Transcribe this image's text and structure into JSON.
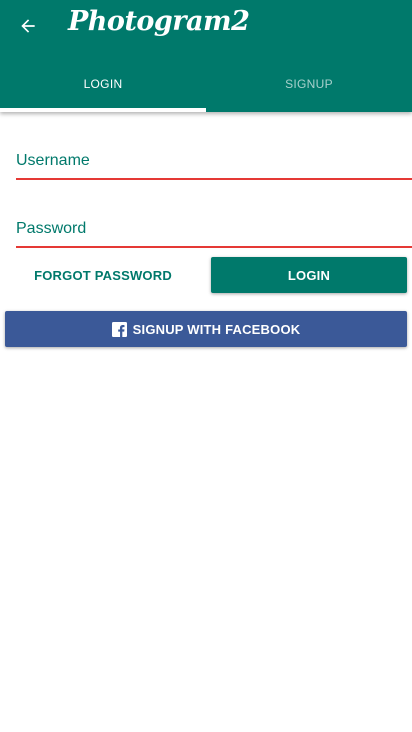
{
  "colors": {
    "primary": "#00796b",
    "error_underline": "#e53935",
    "facebook": "#3b5998",
    "background": "#ffffff"
  },
  "app_bar": {
    "title": "Photogram2",
    "back_icon": "arrow-back-icon"
  },
  "tabs": [
    {
      "label": "LOGIN",
      "selected": true
    },
    {
      "label": "SIGNUP",
      "selected": false
    }
  ],
  "form": {
    "username": {
      "placeholder": "Username",
      "value": ""
    },
    "password": {
      "placeholder": "Password",
      "value": ""
    }
  },
  "buttons": {
    "forgot_password": "FORGOT PASSWORD",
    "login": "LOGIN",
    "facebook": "SIGNUP WITH FACEBOOK",
    "facebook_icon": "facebook-icon"
  }
}
